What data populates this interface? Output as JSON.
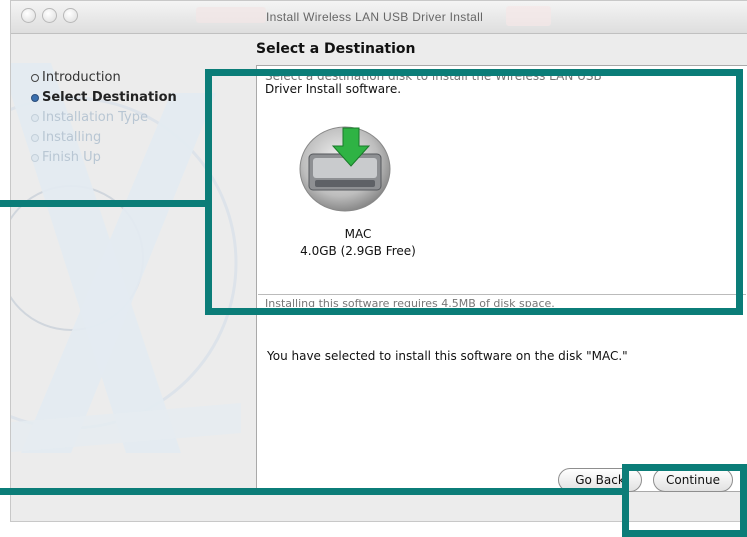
{
  "window": {
    "title": "Install Wireless LAN USB Driver Install"
  },
  "pane": {
    "title": "Select a Destination"
  },
  "sidebar": {
    "steps": [
      {
        "label": "Introduction",
        "state": "done"
      },
      {
        "label": "Select Destination",
        "state": "current"
      },
      {
        "label": "Installation Type",
        "state": "pending"
      },
      {
        "label": "Installing",
        "state": "pending"
      },
      {
        "label": "Finish Up",
        "state": "pending"
      }
    ]
  },
  "content": {
    "instruction_line1": "Select a destination disk to install the Wireless LAN USB",
    "instruction_line2": "Driver Install software.",
    "disk": {
      "name": "MAC",
      "size": "4.0GB (2.9GB Free)",
      "icon": "hard-disk-icon"
    },
    "requirement": "Installing this software requires 4.5MB of disk space.",
    "selected_message": "You have selected to install this software on the disk \"MAC.\""
  },
  "buttons": {
    "go_back": "Go Back",
    "continue": "Continue"
  },
  "colors": {
    "annotation": "#0b7d78",
    "active_step": "#3a6fae"
  }
}
